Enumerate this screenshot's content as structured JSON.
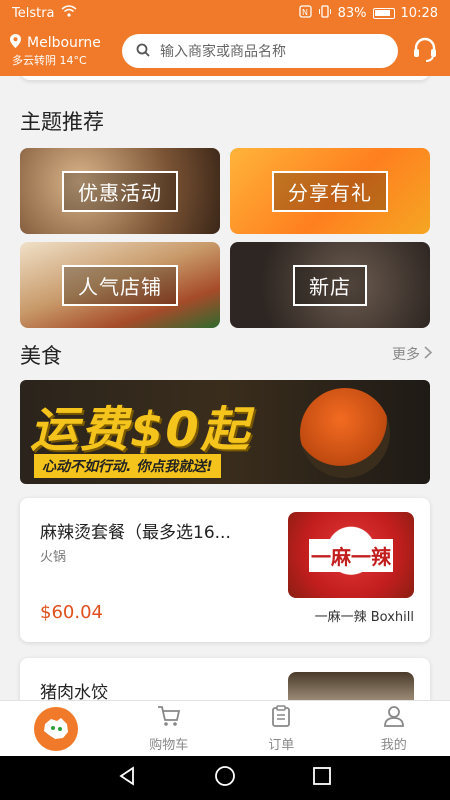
{
  "status": {
    "carrier": "Telstra",
    "battery": "83%",
    "time": "10:28"
  },
  "header": {
    "city": "Melbourne",
    "weather": "多云转阴 14°C",
    "search_placeholder": "输入商家或商品名称"
  },
  "theme": {
    "title": "主题推荐",
    "tiles": [
      {
        "label": "优惠活动"
      },
      {
        "label": "分享有礼"
      },
      {
        "label": "人气店铺"
      },
      {
        "label": "新店"
      }
    ]
  },
  "food": {
    "title": "美食",
    "more": "更多",
    "banner": {
      "headline": "运费$0起",
      "slogan": "心动不如行动. 你点我就送!"
    }
  },
  "items": [
    {
      "name": "麻辣烫套餐（最多选16...",
      "category": "火锅",
      "price": "$60.04",
      "shop": "一麻一辣 Boxhill",
      "logo": "一麻一辣"
    },
    {
      "name": "猪肉水饺"
    }
  ],
  "tabbar": {
    "cart": "购物车",
    "orders": "订单",
    "me": "我的"
  },
  "colors": {
    "accent": "#f07a2a",
    "price": "#e0501e"
  }
}
